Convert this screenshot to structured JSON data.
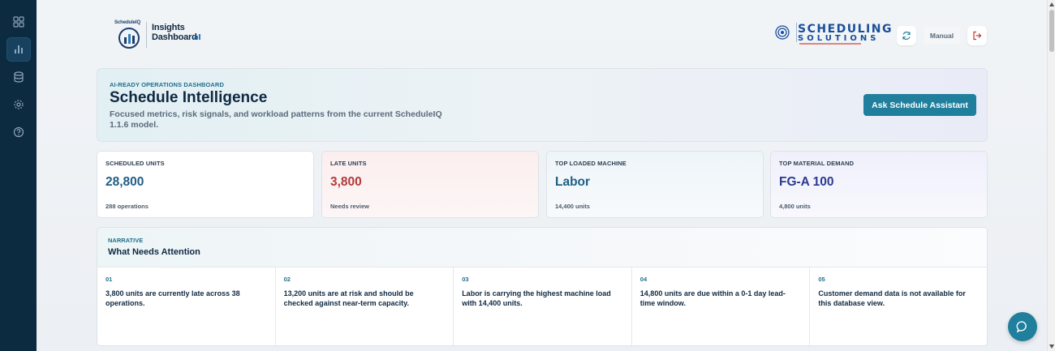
{
  "brand": {
    "mini": "ScheduleIQ",
    "line1": "Insights",
    "line2": "Dashboard"
  },
  "partner": {
    "line1": "SCHEDULING",
    "line2": "SOLUTIONS"
  },
  "header": {
    "manual_label": "Manual"
  },
  "hero": {
    "eyebrow": "AI-READY OPERATIONS DASHBOARD",
    "title": "Schedule Intelligence",
    "subtitle": "Focused metrics, risk signals, and workload patterns from the current ScheduleIQ 1.1.6 model.",
    "cta": "Ask Schedule Assistant"
  },
  "metrics": [
    {
      "label": "SCHEDULED UNITS",
      "value": "28,800",
      "note": "288 operations",
      "color": "#1f5e85"
    },
    {
      "label": "LATE UNITS",
      "value": "3,800",
      "note": "Needs review",
      "color": "#b23a3a"
    },
    {
      "label": "TOP LOADED MACHINE",
      "value": "Labor",
      "note": "14,400 units",
      "color": "#1f5e85"
    },
    {
      "label": "TOP MATERIAL DEMAND",
      "value": "FG-A 100",
      "note": "4,800 units",
      "color": "#2b3a8f"
    }
  ],
  "narrative": {
    "eyebrow": "NARRATIVE",
    "title": "What Needs Attention",
    "items": [
      {
        "num": "01",
        "text": "3,800 units are currently late across 38 operations."
      },
      {
        "num": "02",
        "text": "13,200 units are at risk and should be checked against near-term capacity."
      },
      {
        "num": "03",
        "text": "Labor is carrying the highest machine load with 14,400 units."
      },
      {
        "num": "04",
        "text": "14,800 units are due within a 0-1 day lead-time window."
      },
      {
        "num": "05",
        "text": "Customer demand data is not available for this database view."
      }
    ]
  },
  "sidebar_icons": [
    "grid-icon",
    "bar-chart-icon",
    "database-icon",
    "gear-icon",
    "help-icon"
  ],
  "colors": {
    "sidebar": "#0c2a40",
    "accent": "#1f7f9c",
    "danger": "#b23a3a"
  }
}
